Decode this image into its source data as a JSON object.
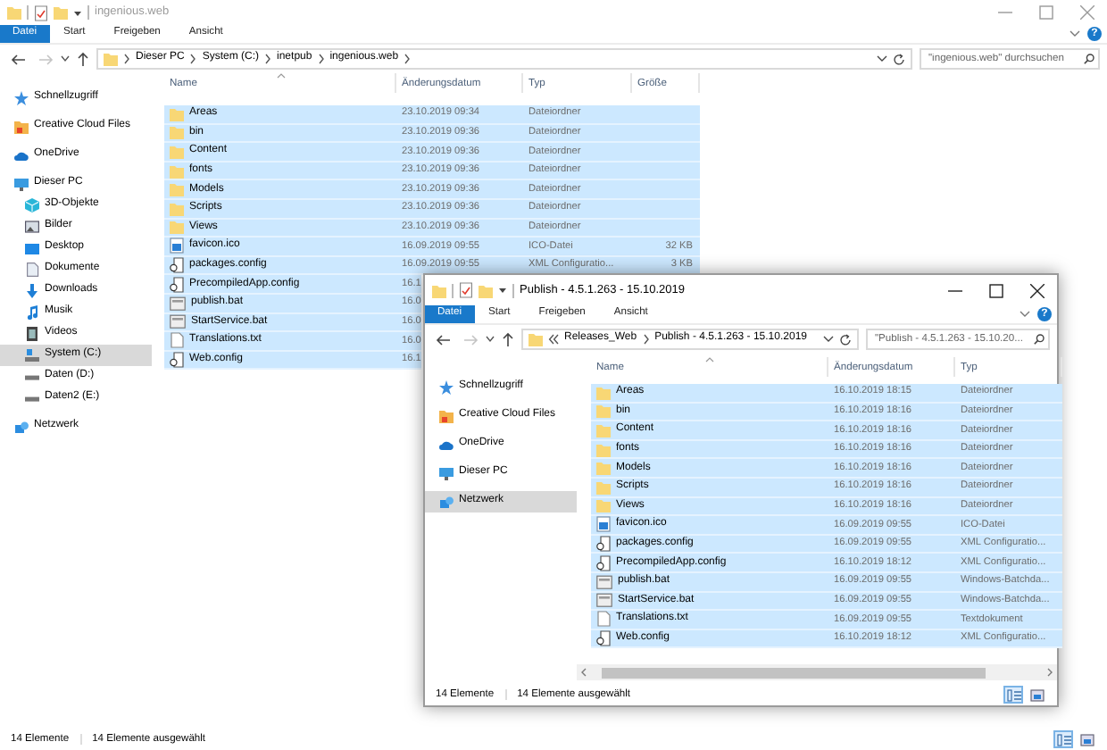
{
  "windows": [
    {
      "title": "ingenious.web",
      "active": false,
      "help": "?",
      "forward_disabled": true,
      "ribbon_tabs": [
        {
          "label": "Datei",
          "kind": "file"
        },
        {
          "label": "Start",
          "kind": "tab"
        },
        {
          "label": "Freigeben",
          "kind": "tab"
        },
        {
          "label": "Ansicht",
          "kind": "tab"
        }
      ],
      "address": {
        "overflow": false,
        "crumbs": [
          "Dieser PC",
          "System (C:)",
          "inetpub",
          "ingenious.web"
        ]
      },
      "search": {
        "placeholder": "\"ingenious.web\" durchsuchen"
      },
      "sidebar": {
        "items": [
          {
            "kind": "quick",
            "label": "Schnellzugriff",
            "selected": false
          },
          {
            "kind": "ccfiles",
            "label": "Creative Cloud Files",
            "selected": false
          },
          {
            "kind": "onedrive",
            "label": "OneDrive",
            "selected": false
          },
          {
            "kind": "pc",
            "label": "Dieser PC",
            "selected": false,
            "children": [
              {
                "kind": "objects3d",
                "label": "3D-Objekte",
                "selected": false
              },
              {
                "kind": "pictures",
                "label": "Bilder",
                "selected": false
              },
              {
                "kind": "desktop",
                "label": "Desktop",
                "selected": false
              },
              {
                "kind": "documents",
                "label": "Dokumente",
                "selected": false
              },
              {
                "kind": "downloads",
                "label": "Downloads",
                "selected": false
              },
              {
                "kind": "music",
                "label": "Musik",
                "selected": false
              },
              {
                "kind": "videos",
                "label": "Videos",
                "selected": false
              },
              {
                "kind": "system",
                "label": "System (C:)",
                "selected": true
              },
              {
                "kind": "drive",
                "label": "Daten (D:)",
                "selected": false
              },
              {
                "kind": "drive",
                "label": "Daten2 (E:)",
                "selected": false
              }
            ]
          },
          {
            "kind": "network",
            "label": "Netzwerk",
            "selected": false
          }
        ]
      },
      "table": {
        "columns": [
          {
            "label": "Name",
            "sorted": true
          },
          {
            "label": "Änderungsdatum",
            "sorted": false
          },
          {
            "label": "Typ",
            "sorted": false
          },
          {
            "label": "Größe",
            "sorted": false
          }
        ],
        "rows": [
          {
            "kind": "folder",
            "name": "Areas",
            "date": "23.10.2019 09:34",
            "type": "Dateiordner",
            "selected": true
          },
          {
            "kind": "folder",
            "name": "bin",
            "date": "23.10.2019 09:36",
            "type": "Dateiordner",
            "selected": true
          },
          {
            "kind": "folder",
            "name": "Content",
            "date": "23.10.2019 09:36",
            "type": "Dateiordner",
            "selected": true
          },
          {
            "kind": "folder",
            "name": "fonts",
            "date": "23.10.2019 09:36",
            "type": "Dateiordner",
            "selected": true
          },
          {
            "kind": "folder",
            "name": "Models",
            "date": "23.10.2019 09:36",
            "type": "Dateiordner",
            "selected": true
          },
          {
            "kind": "folder",
            "name": "Scripts",
            "date": "23.10.2019 09:36",
            "type": "Dateiordner",
            "selected": true
          },
          {
            "kind": "folder",
            "name": "Views",
            "date": "23.10.2019 09:36",
            "type": "Dateiordner",
            "selected": true
          },
          {
            "kind": "image",
            "name": "favicon.ico",
            "date": "16.09.2019 09:55",
            "type": "ICO-Datei",
            "size": "32 KB",
            "selected": true
          },
          {
            "kind": "config",
            "name": "packages.config",
            "date": "16.09.2019 09:55",
            "type": "XML Configuratio...",
            "size": "3 KB",
            "selected": true
          },
          {
            "kind": "config",
            "name": "PrecompiledApp.config",
            "date": "16.1",
            "selected": true
          },
          {
            "kind": "batch",
            "name": "publish.bat",
            "date": "16.0",
            "selected": true
          },
          {
            "kind": "batch",
            "name": "StartService.bat",
            "date": "16.0",
            "selected": true
          },
          {
            "kind": "text",
            "name": "Translations.txt",
            "date": "16.0",
            "selected": true
          },
          {
            "kind": "config",
            "name": "Web.config",
            "date": "16.1",
            "selected": true
          }
        ]
      },
      "status_bar": {
        "count": "14 Elemente",
        "selection": "14 Elemente ausgewählt"
      },
      "view_buttons": [
        {
          "kind": "details",
          "selected": true
        },
        {
          "kind": "thumbnails",
          "selected": false
        }
      ]
    },
    {
      "title": "Publish - 4.5.1.263 - 15.10.2019",
      "active": true,
      "help": "?",
      "forward_disabled": true,
      "ribbon_tabs": [
        {
          "label": "Datei",
          "kind": "file"
        },
        {
          "label": "Start",
          "kind": "tab"
        },
        {
          "label": "Freigeben",
          "kind": "tab"
        },
        {
          "label": "Ansicht",
          "kind": "tab"
        }
      ],
      "address": {
        "overflow": true,
        "crumbs": [
          "Releases_Web",
          "Publish - 4.5.1.263 - 15.10.2019"
        ]
      },
      "search": {
        "placeholder": "\"Publish - 4.5.1.263 - 15.10.20..."
      },
      "sidebar": {
        "items": [
          {
            "kind": "quick",
            "label": "Schnellzugriff",
            "selected": false
          },
          {
            "kind": "ccfiles",
            "label": "Creative Cloud Files",
            "selected": false
          },
          {
            "kind": "onedrive",
            "label": "OneDrive",
            "selected": false
          },
          {
            "kind": "pc",
            "label": "Dieser PC",
            "selected": false
          },
          {
            "kind": "network",
            "label": "Netzwerk",
            "selected": true
          }
        ]
      },
      "table": {
        "columns": [
          {
            "label": "Name",
            "sorted": true
          },
          {
            "label": "Änderungsdatum",
            "sorted": false
          },
          {
            "label": "Typ",
            "sorted": false
          }
        ],
        "rows": [
          {
            "kind": "folder",
            "name": "Areas",
            "date": "16.10.2019 18:15",
            "type": "Dateiordner",
            "selected": true
          },
          {
            "kind": "folder",
            "name": "bin",
            "date": "16.10.2019 18:16",
            "type": "Dateiordner",
            "selected": true
          },
          {
            "kind": "folder",
            "name": "Content",
            "date": "16.10.2019 18:16",
            "type": "Dateiordner",
            "selected": true
          },
          {
            "kind": "folder",
            "name": "fonts",
            "date": "16.10.2019 18:16",
            "type": "Dateiordner",
            "selected": true
          },
          {
            "kind": "folder",
            "name": "Models",
            "date": "16.10.2019 18:16",
            "type": "Dateiordner",
            "selected": true
          },
          {
            "kind": "folder",
            "name": "Scripts",
            "date": "16.10.2019 18:16",
            "type": "Dateiordner",
            "selected": true
          },
          {
            "kind": "folder",
            "name": "Views",
            "date": "16.10.2019 18:16",
            "type": "Dateiordner",
            "selected": true
          },
          {
            "kind": "image",
            "name": "favicon.ico",
            "date": "16.09.2019 09:55",
            "type": "ICO-Datei",
            "selected": true
          },
          {
            "kind": "config",
            "name": "packages.config",
            "date": "16.09.2019 09:55",
            "type": "XML Configuratio...",
            "selected": true
          },
          {
            "kind": "config",
            "name": "PrecompiledApp.config",
            "date": "16.10.2019 18:12",
            "type": "XML Configuratio...",
            "selected": true
          },
          {
            "kind": "batch",
            "name": "publish.bat",
            "date": "16.09.2019 09:55",
            "type": "Windows-Batchda...",
            "selected": true
          },
          {
            "kind": "batch",
            "name": "StartService.bat",
            "date": "16.09.2019 09:55",
            "type": "Windows-Batchda...",
            "selected": true
          },
          {
            "kind": "text",
            "name": "Translations.txt",
            "date": "16.09.2019 09:55",
            "type": "Textdokument",
            "selected": true
          },
          {
            "kind": "config",
            "name": "Web.config",
            "date": "16.10.2019 18:12",
            "type": "XML Configuratio...",
            "selected": true
          }
        ]
      },
      "status_bar": {
        "count": "14 Elemente",
        "selection": "14 Elemente ausgewählt"
      },
      "view_buttons": [
        {
          "kind": "details",
          "selected": true
        },
        {
          "kind": "thumbnails",
          "selected": false
        }
      ]
    }
  ]
}
